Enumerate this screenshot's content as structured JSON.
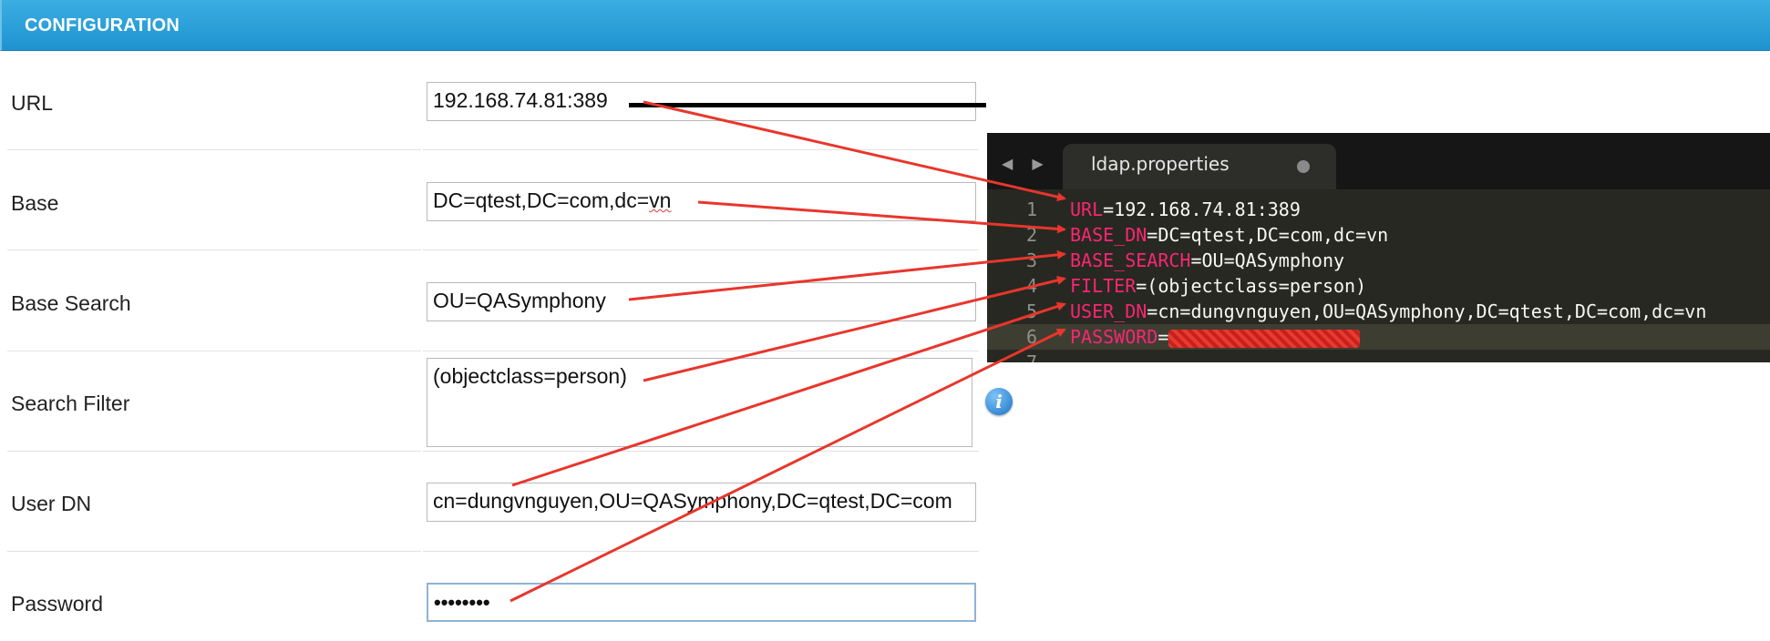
{
  "header": {
    "title": "CONFIGURATION"
  },
  "form": {
    "rows": [
      {
        "label": "URL",
        "value": "192.168.74.81:389"
      },
      {
        "label": "Base",
        "value_prefix": "DC=qtest,DC=com,dc=",
        "value_suffix": "vn"
      },
      {
        "label": "Base Search",
        "value": "OU=QASymphony"
      },
      {
        "label": "Search Filter",
        "value": "(objectclass=person)"
      },
      {
        "label": "User DN",
        "value": "cn=dungvnguyen,OU=QASymphony,DC=qtest,DC=com"
      },
      {
        "label": "Password",
        "value": "••••••••"
      }
    ]
  },
  "icons": {
    "info": "info-icon",
    "tab_back": "arrow-left-icon",
    "tab_forward": "arrow-right-icon"
  },
  "editor": {
    "tab_nav": "◀ ▶",
    "tab_title": "ldap.properties",
    "lines": [
      {
        "num": "1",
        "key": "URL",
        "value": "=192.168.74.81:389"
      },
      {
        "num": "2",
        "key": "BASE_DN",
        "value": "=DC=qtest,DC=com,dc=vn"
      },
      {
        "num": "3",
        "key": "BASE_SEARCH",
        "value": "=OU=QASymphony"
      },
      {
        "num": "4",
        "key": "FILTER",
        "value": "=(objectclass=person)"
      },
      {
        "num": "5",
        "key": "USER_DN",
        "value": "=cn=dungvnguyen,OU=QASymphony,DC=qtest,DC=com,dc=vn"
      },
      {
        "num": "6",
        "key": "PASSWORD",
        "value": "="
      },
      {
        "num": "7",
        "key": "",
        "value": ""
      }
    ]
  },
  "colors": {
    "header": "#2aa1da",
    "editor_bg": "#272822",
    "editor_key": "#f92672",
    "arrow": "#e8362c"
  }
}
